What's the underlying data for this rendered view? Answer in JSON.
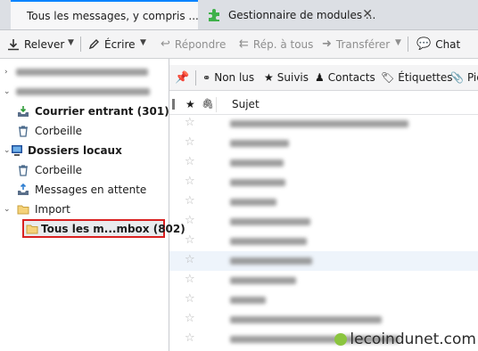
{
  "tabs": [
    {
      "label": "Tous les messages, y compris ..."
    },
    {
      "label": "Gestionnaire de modules ..."
    }
  ],
  "toolbar": {
    "relever": "Relever",
    "ecrire": "Écrire",
    "repondre": "Répondre",
    "rep_tous": "Rép. à tous",
    "transferer": "Transférer",
    "chat": "Chat"
  },
  "folders": {
    "inbox": "Courrier entrant (301)",
    "trash1": "Corbeille",
    "local": "Dossiers locaux",
    "trash2": "Corbeille",
    "outbox": "Messages en attente",
    "import": "Import",
    "selected": "Tous les m...mbox (802)"
  },
  "quickfilter": {
    "unread": "Non lus",
    "starred": "Suivis",
    "contacts": "Contacts",
    "tags": "Étiquettes",
    "attach": "Piè"
  },
  "columns": {
    "subject": "Sujet"
  },
  "watermark": "lecoindunet.com",
  "colors": {
    "accent": "#0a84ff",
    "selection_border": "#d92121",
    "toolbar_bg": "#f4f4f5"
  }
}
